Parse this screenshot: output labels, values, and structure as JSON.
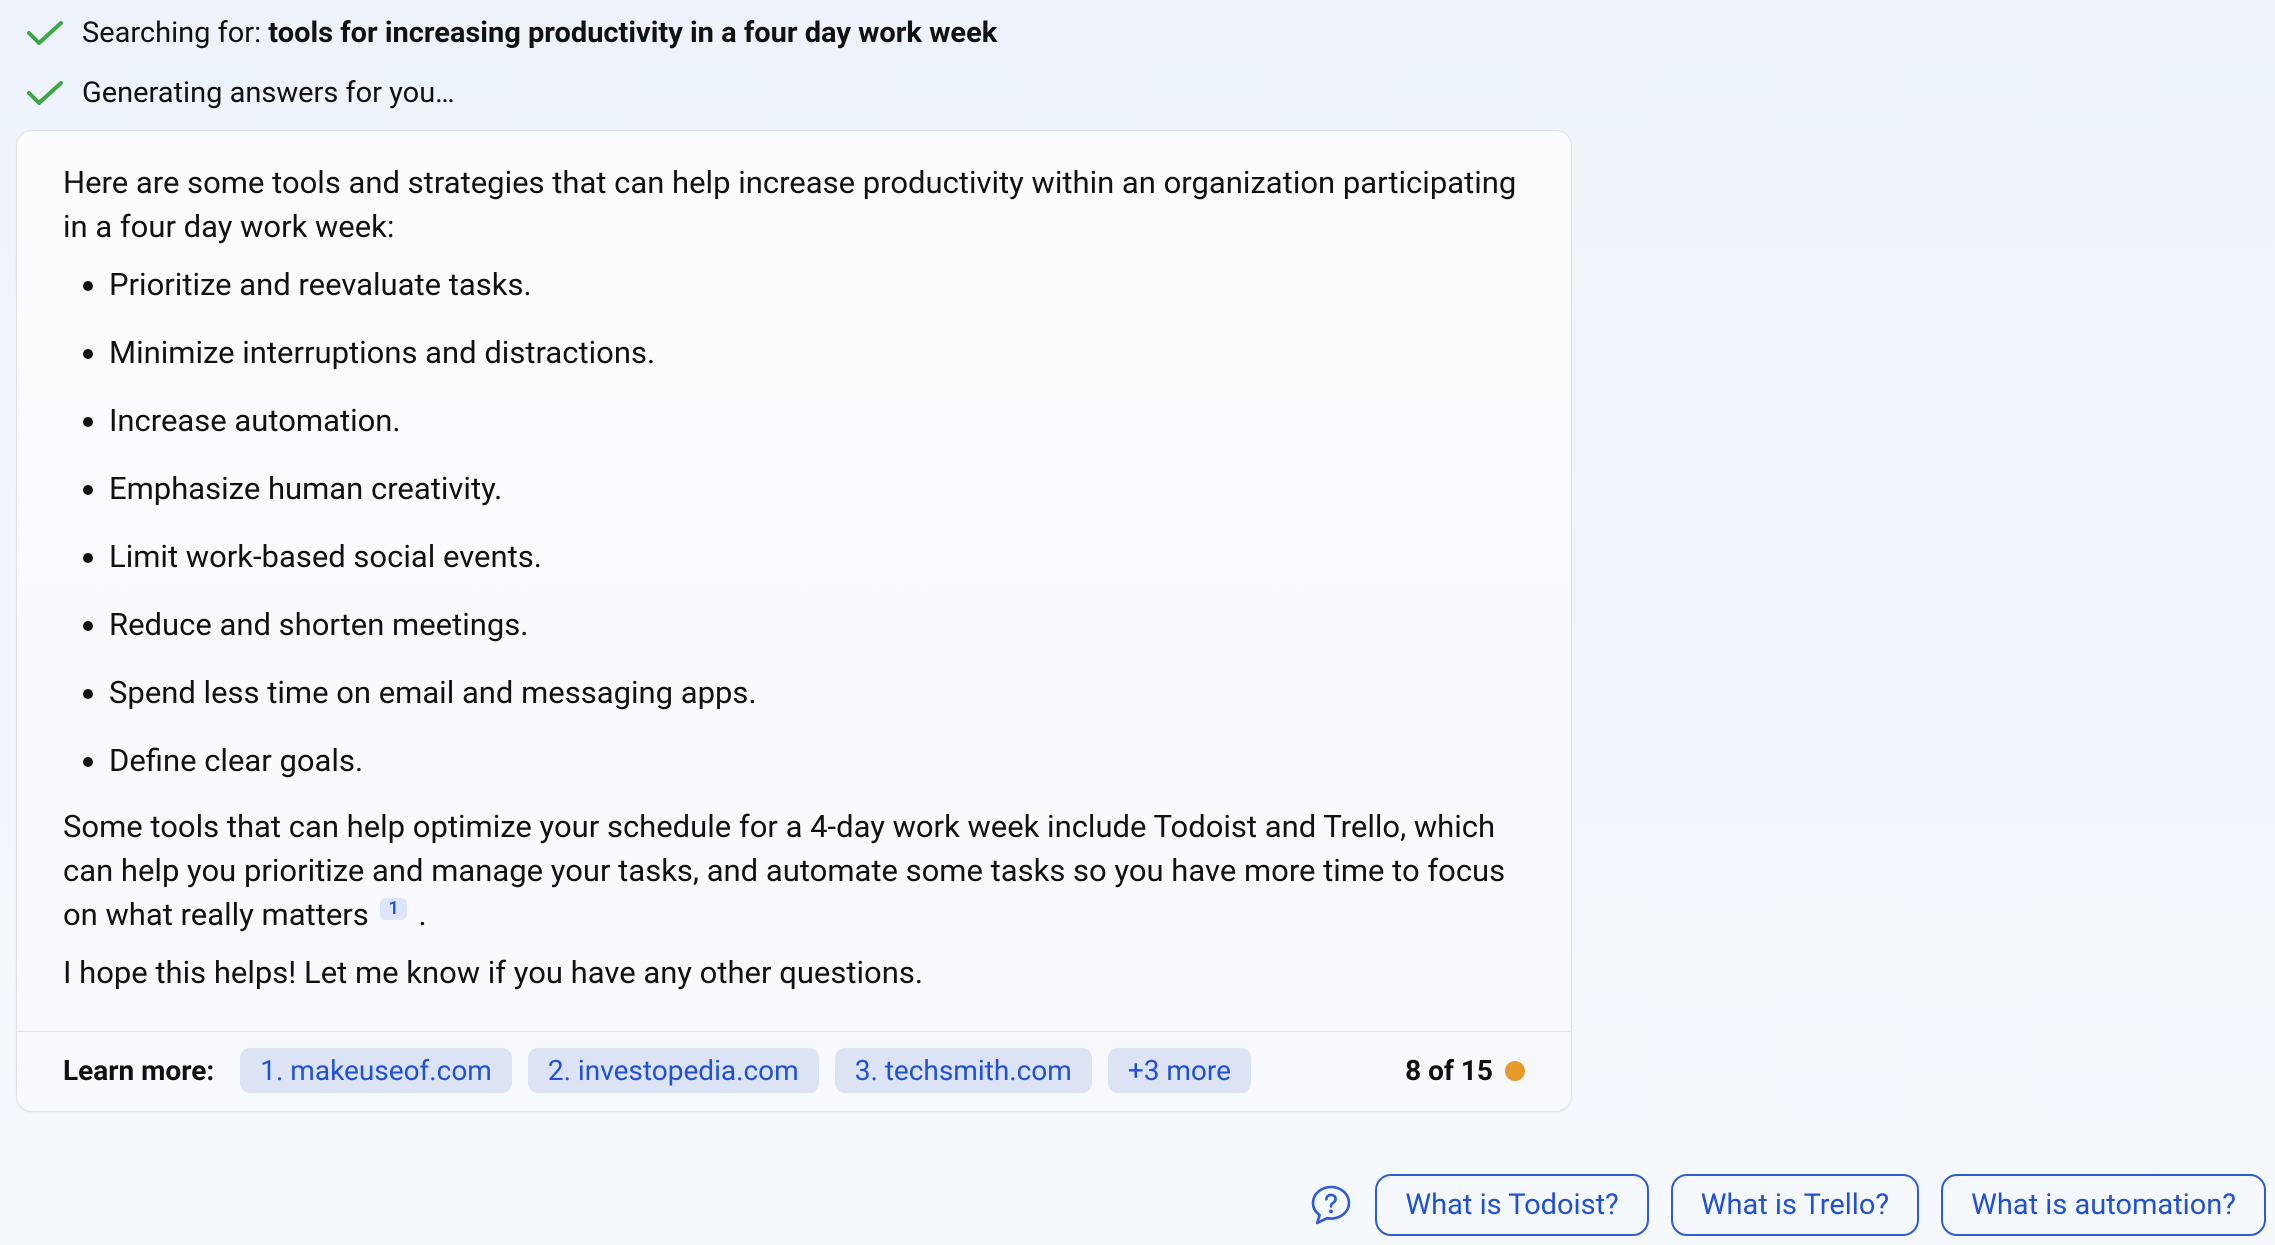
{
  "status": {
    "searching_prefix": "Searching for: ",
    "searching_query": "tools for increasing productivity in a four day work week",
    "generating": "Generating answers for you…"
  },
  "answer": {
    "intro": "Here are some tools and strategies that can help increase productivity within an organization participating in a four day work week:",
    "bullets": [
      "Prioritize and reevaluate tasks.",
      "Minimize interruptions and distractions.",
      "Increase automation.",
      "Emphasize human creativity.",
      "Limit work-based social events.",
      "Reduce and shorten meetings.",
      "Spend less time on email and messaging apps.",
      "Define clear goals."
    ],
    "para2_pre": "Some tools that can help optimize your schedule for a 4-day work week include Todoist and Trello, which can help you prioritize and manage your tasks, and automate some tasks so you have more time to focus on what really matters",
    "para2_citation": "1",
    "para2_post": ".",
    "closing": "I hope this helps! Let me know if you have any other questions."
  },
  "footer": {
    "learnmore_label": "Learn more:",
    "sources": [
      "1. makeuseof.com",
      "2. investopedia.com",
      "3. techsmith.com"
    ],
    "more_label": "+3 more",
    "counter": "8 of 15"
  },
  "suggestions": [
    "What is Todoist?",
    "What is Trello?",
    "What is automation?"
  ]
}
